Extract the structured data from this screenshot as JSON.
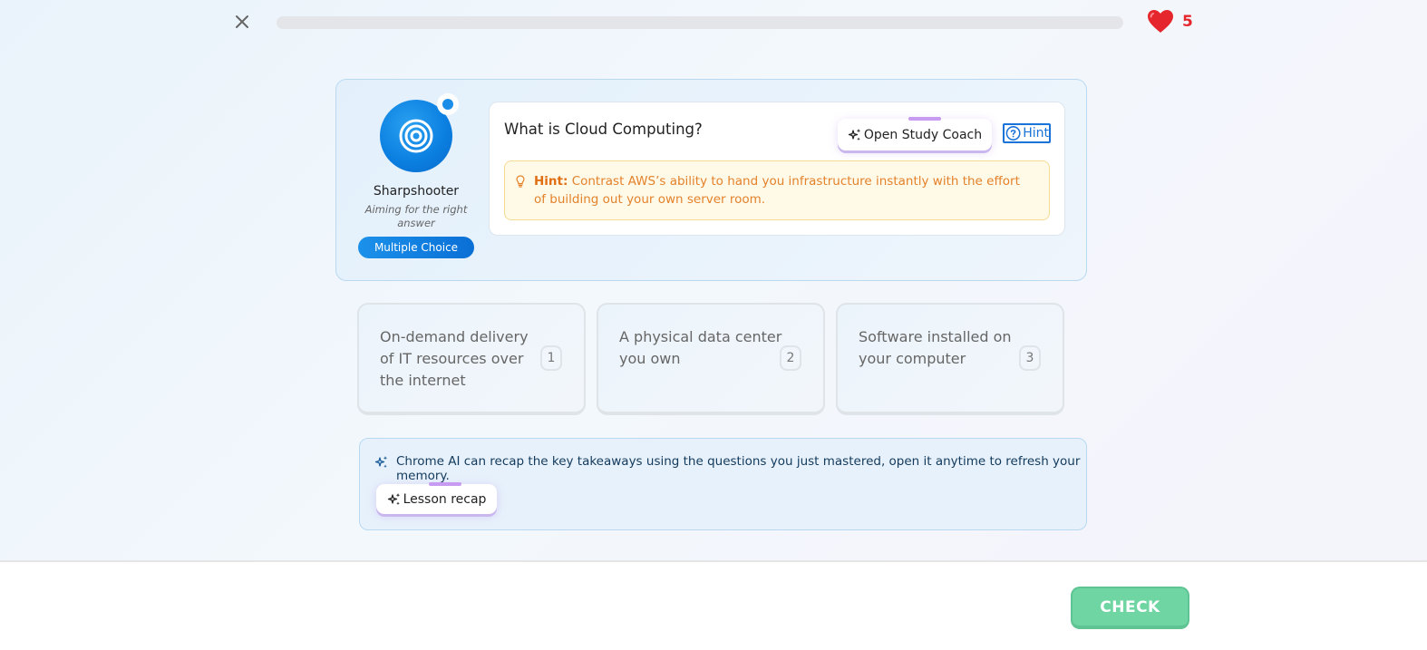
{
  "header": {
    "progress_percent": 0,
    "hearts": "5"
  },
  "mascot": {
    "name": "Sharpshooter",
    "tagline": "Aiming for the right answer",
    "type_pill": "Multiple Choice"
  },
  "question": {
    "text": "What is Cloud Computing?",
    "coach_label": "Open Study Coach",
    "hint_label": "Hint",
    "hint_prefix": "Hint:",
    "hint_text": "Contrast AWS’s ability to hand you infrastructure instantly with the effort of building out your own server room."
  },
  "answers": [
    {
      "text": "On-demand delivery of IT resources over the internet",
      "num": "1"
    },
    {
      "text": "A physical data center you own",
      "num": "2"
    },
    {
      "text": "Software installed on your computer",
      "num": "3"
    }
  ],
  "recap": {
    "text": "Chrome AI can recap the key takeaways using the questions you just mastered, open it anytime to refresh your memory.",
    "button_label": "Lesson recap"
  },
  "footer": {
    "check_label": "CHECK"
  },
  "colors": {
    "heart": "#e5262d",
    "accent_blue": "#1a73d9",
    "check_green": "#6fd6a3",
    "hint_orange": "#e3822b"
  }
}
